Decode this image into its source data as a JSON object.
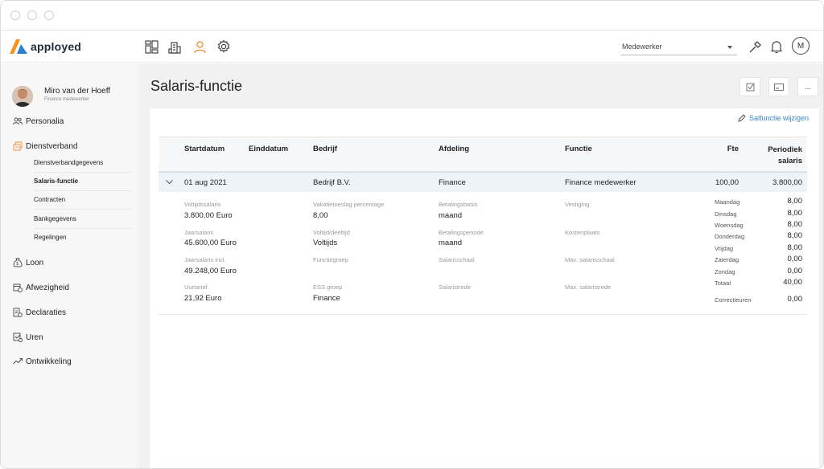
{
  "app": {
    "logo_text": "apployed",
    "brand_colors": [
      "#f7941d",
      "#2f7fd1"
    ]
  },
  "header": {
    "icons": [
      "dashboard-icon",
      "building-icon",
      "person-icon",
      "gear-icon"
    ],
    "role_select_value": "Medewerker",
    "right_icons": [
      "wrench-icon",
      "bell-icon"
    ],
    "avatar_initial": "M"
  },
  "sidebar": {
    "user": {
      "name": "Miro van der Hoeff",
      "role": "Finance medewerker"
    },
    "items": [
      {
        "label": "Personalia",
        "icon": "people-icon"
      },
      {
        "label": "Dienstverband",
        "icon": "contract-icon"
      },
      {
        "label": "Loon",
        "icon": "money-bag-icon"
      },
      {
        "label": "Afwezigheid",
        "icon": "calendar-clock-icon"
      },
      {
        "label": "Declaraties",
        "icon": "receipt-icon"
      },
      {
        "label": "Uren",
        "icon": "timesheet-icon"
      },
      {
        "label": "Ontwikkeling",
        "icon": "trend-icon"
      }
    ],
    "sub_items": [
      {
        "label": "Dienstverbandgegevens",
        "active": false
      },
      {
        "label": "Salaris-functie",
        "active": true
      },
      {
        "label": "Contracten",
        "active": false
      },
      {
        "label": "Bankgegevens",
        "active": false
      },
      {
        "label": "Regelingen",
        "active": false
      }
    ]
  },
  "page": {
    "title": "Salaris-functie",
    "toolbar": [
      "checkbox-icon",
      "card-icon",
      "..."
    ],
    "edit_link": "Salfunctie wijzigen"
  },
  "table": {
    "headers": {
      "startdatum": "Startdatum",
      "einddatum": "Einddatum",
      "bedrijf": "Bedrijf",
      "afdeling": "Afdeling",
      "functie": "Functie",
      "fte": "Fte",
      "periodiek_line1": "Periodiek",
      "periodiek_line2": "salaris"
    },
    "row": {
      "startdatum": "01 aug 2021",
      "einddatum": "",
      "bedrijf": "Bedrijf B.V.",
      "afdeling": "Finance",
      "functie": "Finance medewerker",
      "fte": "100,00",
      "periodiek_salaris": "3.800,00"
    }
  },
  "details": {
    "col1": [
      {
        "label": "Voltijdssalaris",
        "value": "3.800,00 Euro"
      },
      {
        "label": "Jaarsalaris",
        "value": "45.600,00 Euro"
      },
      {
        "label": "Jaarsalaris incl.",
        "value": "49.248,00 Euro"
      },
      {
        "label": "Uurtarief",
        "value": "21,92 Euro"
      }
    ],
    "col2": [
      {
        "label": "Vakatietoeslag percentage",
        "value": "8,00"
      },
      {
        "label": "Voltijd/deeltijd",
        "value": "Voltijds"
      },
      {
        "label": "Functiegroep",
        "value": ""
      },
      {
        "label": "ESS groep",
        "value": "Finance"
      }
    ],
    "col3": [
      {
        "label": "Betalingsbasis",
        "value": "maand"
      },
      {
        "label": "Betalingsperiode",
        "value": "maand"
      },
      {
        "label": "Salarisschaal",
        "value": ""
      },
      {
        "label": "Salaristrede",
        "value": ""
      }
    ],
    "col4": [
      {
        "label": "Vestiging",
        "value": ""
      },
      {
        "label": "Kostenplaats",
        "value": ""
      },
      {
        "label": "Max. salarisschaal",
        "value": ""
      },
      {
        "label": "Max. salaristrede",
        "value": ""
      }
    ],
    "hours": [
      {
        "label": "Maandag",
        "value": "8,00"
      },
      {
        "label": "Dinsdag",
        "value": "8,00"
      },
      {
        "label": "Woensdag",
        "value": "8,00"
      },
      {
        "label": "Donderdag",
        "value": "8,00"
      },
      {
        "label": "Vrijdag",
        "value": "8,00"
      },
      {
        "label": "Zaterdag",
        "value": "0,00"
      },
      {
        "label": "Zondag",
        "value": "0,00"
      },
      {
        "label": "Totaal",
        "value": "40,00"
      }
    ],
    "correctie": {
      "label": "Correctieuren",
      "value": "0,00"
    }
  }
}
